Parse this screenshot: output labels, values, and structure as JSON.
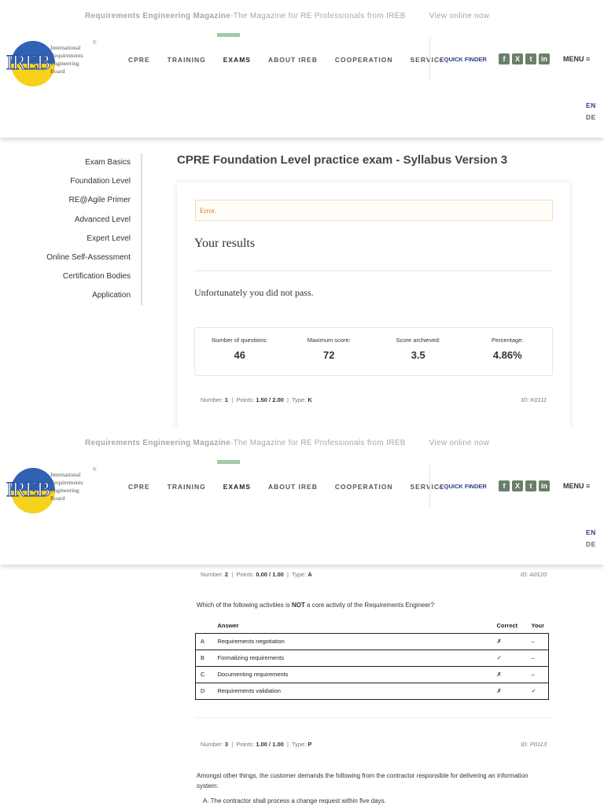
{
  "topbar": {
    "magazine": "Requirements Engineering Magazine",
    "tagline": "-The Magazine for RE Professionals from IREB",
    "view_online": "View online now"
  },
  "logo": {
    "abbr": "IREB",
    "lines": [
      "International",
      "Requirements",
      "Engineering",
      "Board"
    ],
    "reg": "®"
  },
  "nav": [
    "CPRE",
    "TRAINING",
    "EXAMS",
    "ABOUT IREB",
    "COOPERATION",
    "SERVICE"
  ],
  "quick_finder": "QUICK FINDER",
  "social": {
    "facebook": "f",
    "xing": "X",
    "twitter": "t",
    "linkedin": "in"
  },
  "menu": "MENU ≡",
  "lang": {
    "en": "EN",
    "de": "DE"
  },
  "sidebar": [
    "Exam Basics",
    "Foundation Level",
    "RE@Agile Primer",
    "Advanced Level",
    "Expert Level",
    "Online Self-Assessment",
    "Certification Bodies",
    "Application"
  ],
  "page_title": "CPRE Foundation Level practice exam - Syllabus Version 3",
  "error": "Error.",
  "results_heading": "Your results",
  "result_message": "Unfortunately you did not pass.",
  "stats": [
    {
      "label": "Number of questions:",
      "value": "46"
    },
    {
      "label": "Maximum score:",
      "value": "72"
    },
    {
      "label": "Score archieved:",
      "value": "3.5"
    },
    {
      "label": "Percentage:",
      "value": "4.86%"
    }
  ],
  "meta_labels": {
    "number": "Number:",
    "points": "Points:",
    "type": "Type:"
  },
  "questions": [
    {
      "number": "1",
      "points": "1.50 / 2.00",
      "type": "K",
      "id": "ID: K0111"
    },
    {
      "number": "2",
      "points": "0.00 / 1.00",
      "type": "A",
      "id": "ID: A0120",
      "text_pre": "Which of the following activities is ",
      "text_bold": "NOT",
      "text_post": " a core activity of the Requirements Engineer?",
      "table_headers": {
        "answer": "Answer",
        "correct": "Correct",
        "your": "Your"
      },
      "answers": [
        {
          "letter": "A",
          "text": "Requirements negotiation",
          "correct": "✗",
          "your": "–"
        },
        {
          "letter": "B",
          "text": "Formalizing requirements",
          "correct": "✓",
          "your": "–"
        },
        {
          "letter": "C",
          "text": "Documenting requirements",
          "correct": "✗",
          "your": "–"
        },
        {
          "letter": "D",
          "text": "Requirements validation",
          "correct": "✗",
          "your": "✓"
        }
      ]
    },
    {
      "number": "3",
      "points": "1.00 / 1.00",
      "type": "P",
      "id": "ID: P0113",
      "text": "Amongst other things, the customer demands the following from the contractor responsible for delivering an information system:",
      "item_a": "A. The contractor shall process a change request within five days."
    }
  ]
}
